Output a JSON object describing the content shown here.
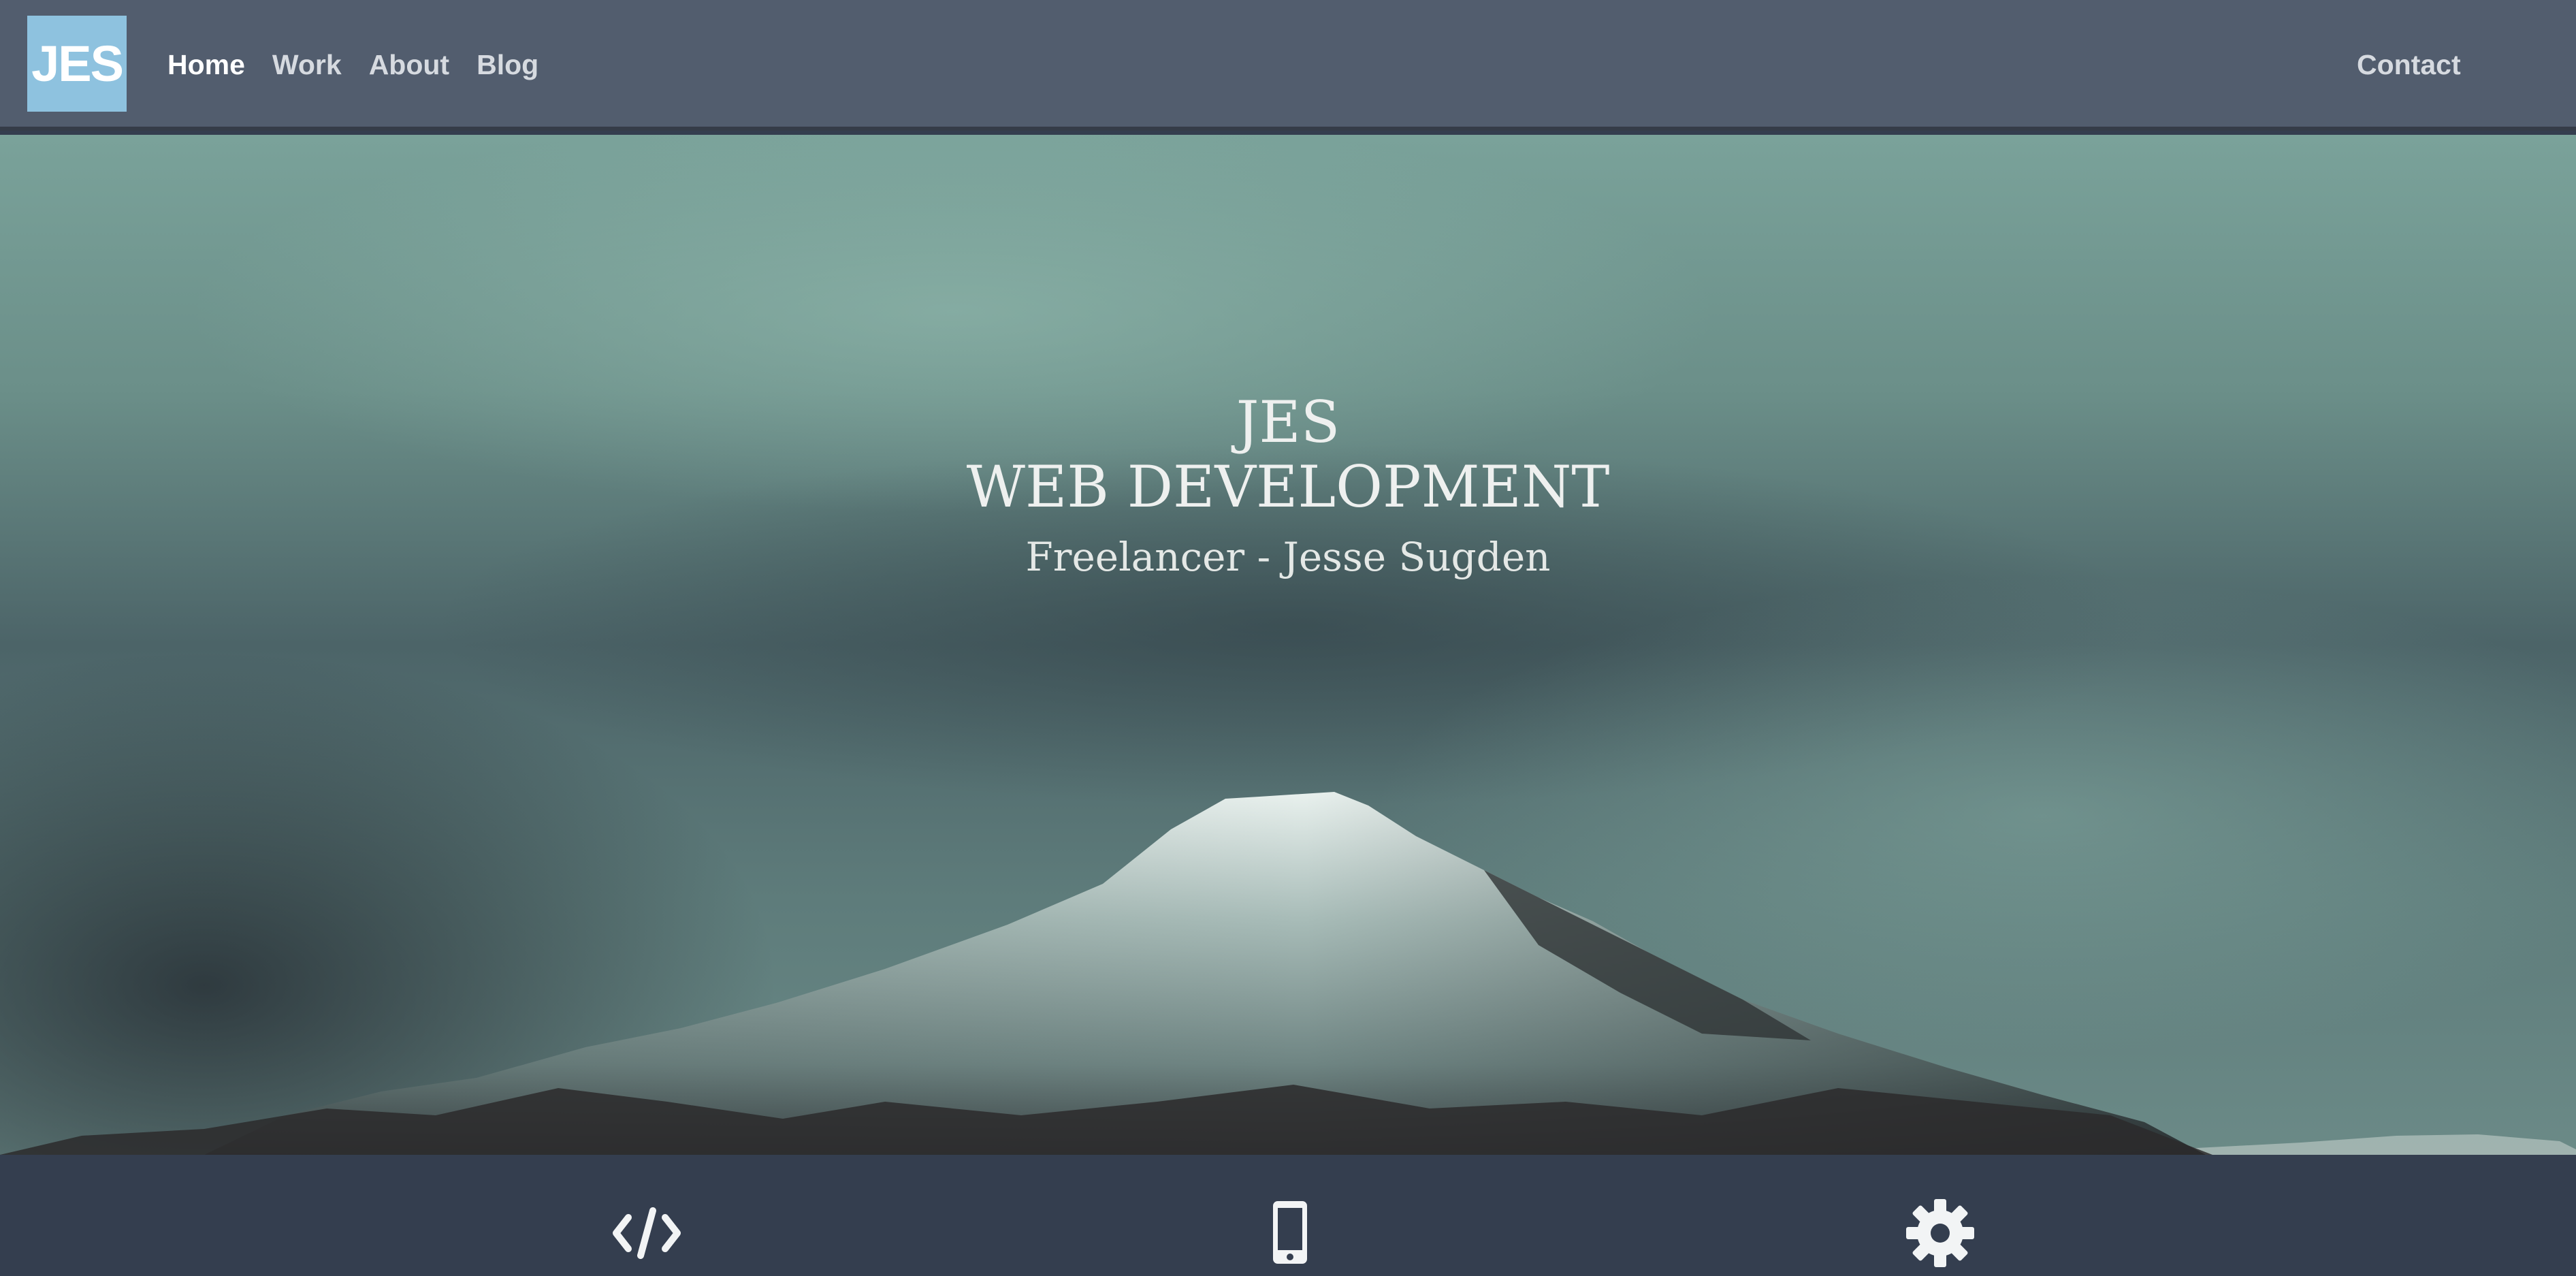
{
  "nav": {
    "logo": "JES",
    "links": [
      "Home",
      "Work",
      "About",
      "Blog"
    ],
    "active_index": 0,
    "contact": "Contact"
  },
  "hero": {
    "title_line1": "JES",
    "title_line2": "WEB DEVELOPMENT",
    "subtitle": "Freelancer - Jesse Sugden"
  },
  "services": {
    "icons": [
      "code-icon",
      "mobile-phone-icon",
      "gear-icon"
    ]
  },
  "colors": {
    "navbar": "#525d6e",
    "logo_bg": "#8ec2df",
    "services_bg": "#343e4f",
    "hero_text": "#eef0ef"
  }
}
